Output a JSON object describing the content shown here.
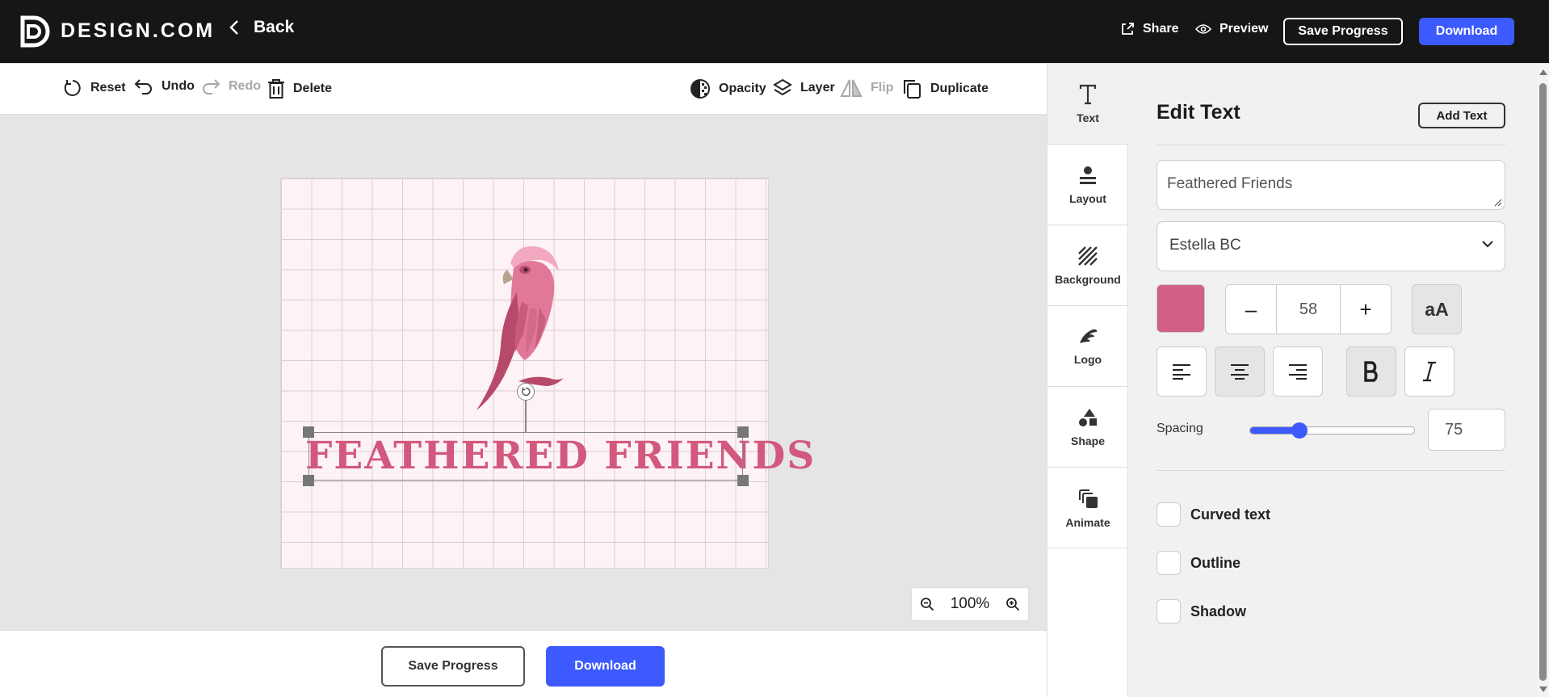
{
  "topbar": {
    "brand": "DESIGN.COM",
    "back_label": "Back",
    "share_label": "Share",
    "preview_label": "Preview",
    "save_progress_label": "Save Progress",
    "download_label": "Download"
  },
  "toolbar": {
    "reset": "Reset",
    "undo": "Undo",
    "redo": "Redo",
    "delete": "Delete",
    "opacity": "Opacity",
    "layer": "Layer",
    "flip": "Flip",
    "duplicate": "Duplicate"
  },
  "canvas": {
    "logo_text": "FEATHERED FRIENDS",
    "zoom_level": "100%"
  },
  "bottombar": {
    "save_progress_label": "Save Progress",
    "download_label": "Download"
  },
  "side_tabs": [
    {
      "label": "Text",
      "icon": "text-icon"
    },
    {
      "label": "Layout",
      "icon": "layout-icon"
    },
    {
      "label": "Background",
      "icon": "background-icon"
    },
    {
      "label": "Logo",
      "icon": "logo-icon"
    },
    {
      "label": "Shape",
      "icon": "shape-icon"
    },
    {
      "label": "Animate",
      "icon": "animate-icon"
    }
  ],
  "panel": {
    "title": "Edit Text",
    "add_text_label": "Add Text",
    "text_value": "Feathered Friends",
    "font": "Estella BC",
    "color": "#d15f87",
    "font_size": "58",
    "case_label": "aA",
    "spacing_label": "Spacing",
    "spacing_value": "75",
    "spacing_fraction": 0.3,
    "options": [
      "Curved text",
      "Outline",
      "Shadow"
    ]
  },
  "colors": {
    "accent": "#3d5afe",
    "topbar": "#161616",
    "text_pink": "#d2587e"
  }
}
